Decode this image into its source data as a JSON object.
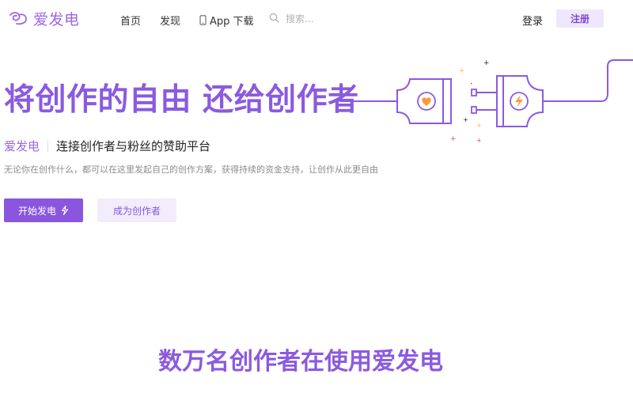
{
  "brand": {
    "name": "爱发电",
    "accent_color": "#8b5ae0",
    "icon": "aifadian-logo-icon"
  },
  "nav": {
    "items": [
      {
        "label": "首页"
      },
      {
        "label": "发现"
      },
      {
        "label": "App 下载",
        "icon": "phone-icon"
      }
    ]
  },
  "search": {
    "icon": "search-icon",
    "placeholder": "搜索..."
  },
  "auth": {
    "login_label": "登录",
    "register_label": "注册"
  },
  "hero": {
    "title": "将创作的自由 还给创作者",
    "brand_label": "爱发电",
    "tagline": "连接创作者与粉丝的赞助平台",
    "description": "无论你在创作什么，都可以在这里发起自己的创作方案，获得持续的资金支持，让创作从此更自由",
    "start_button": {
      "label": "开始发电",
      "icon": "lightning-icon"
    },
    "creator_button": {
      "label": "成为创作者"
    },
    "illustration": "plug-socket-icon"
  },
  "section": {
    "title": "数万名创作者在使用爱发电"
  }
}
